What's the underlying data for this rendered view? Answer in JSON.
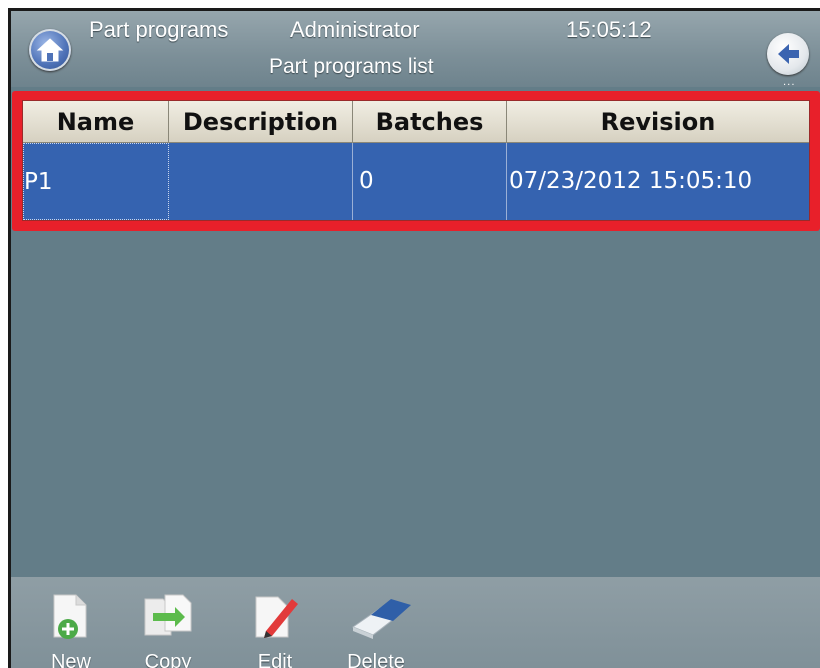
{
  "header": {
    "section": "Part programs",
    "user": "Administrator",
    "time": "15:05:12",
    "subtitle": "Part programs list",
    "back_dots": "..."
  },
  "table": {
    "columns": [
      "Name",
      "Description",
      "Batches",
      "Revision"
    ],
    "rows": [
      {
        "name": "P1",
        "description": "",
        "batches": "0",
        "revision": "07/23/2012 15:05:10"
      }
    ]
  },
  "toolbar": {
    "buttons": [
      {
        "label": "New",
        "icon": "new-document-icon"
      },
      {
        "label": "Copy",
        "icon": "copy-document-icon"
      },
      {
        "label": "Edit",
        "icon": "edit-document-icon"
      },
      {
        "label": "Delete",
        "icon": "eraser-icon"
      }
    ]
  },
  "colors": {
    "background": "#637d88",
    "selection": "#3563b0",
    "highlight_border": "#e8202a",
    "header_bar": "#8a9ca4"
  }
}
